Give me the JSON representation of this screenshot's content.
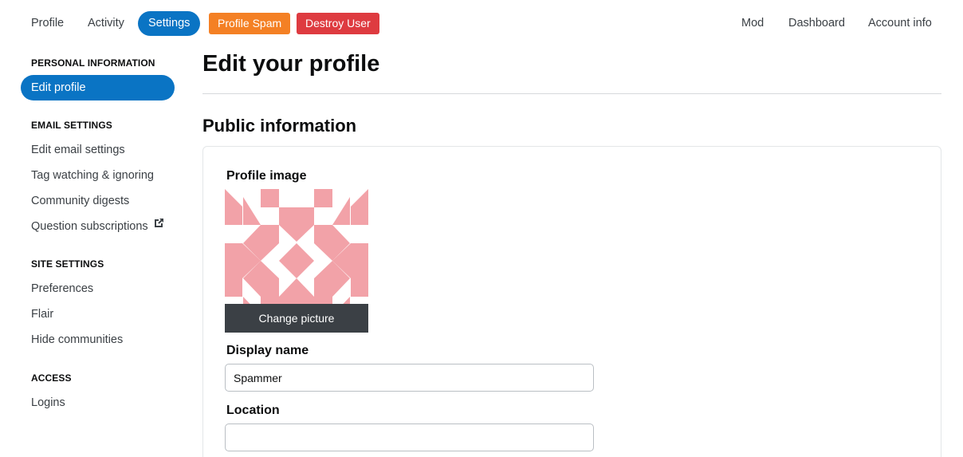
{
  "topnav": {
    "profile": "Profile",
    "activity": "Activity",
    "settings": "Settings",
    "profile_spam": "Profile Spam",
    "destroy_user": "Destroy User",
    "mod": "Mod",
    "dashboard": "Dashboard",
    "account_info": "Account info"
  },
  "sidebar": {
    "personal_heading": "PERSONAL INFORMATION",
    "edit_profile": "Edit profile",
    "email_heading": "EMAIL SETTINGS",
    "edit_email": "Edit email settings",
    "tag_watching": "Tag watching & ignoring",
    "community_digests": "Community digests",
    "question_subscriptions": "Question subscriptions",
    "site_heading": "SITE SETTINGS",
    "preferences": "Preferences",
    "flair": "Flair",
    "hide_communities": "Hide communities",
    "access_heading": "ACCESS",
    "logins": "Logins"
  },
  "main": {
    "title": "Edit your profile",
    "section_title": "Public information",
    "profile_image_label": "Profile image",
    "change_picture": "Change picture",
    "display_name_label": "Display name",
    "display_name_value": "Spammer",
    "location_label": "Location",
    "location_value": ""
  },
  "colors": {
    "accent": "#0a74c4",
    "orange": "#f48024",
    "red": "#de3b40",
    "identicon": "#f2a2a8"
  },
  "icons": {
    "external_link": "external-link-icon"
  }
}
